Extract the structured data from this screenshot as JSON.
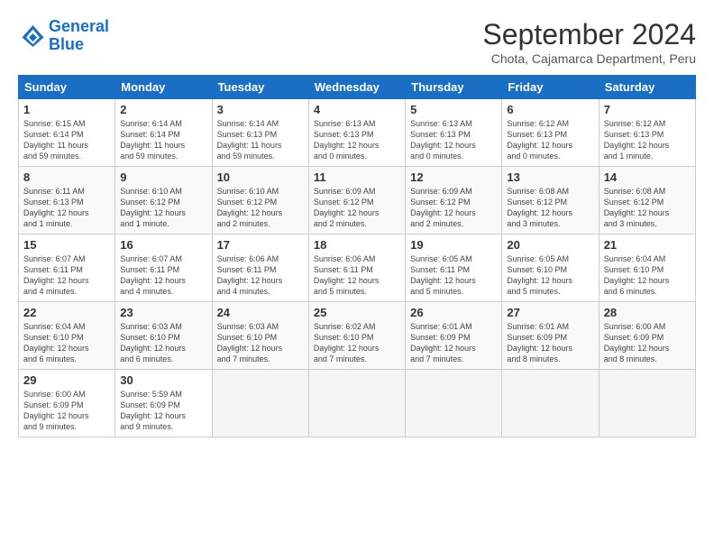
{
  "logo": {
    "line1": "General",
    "line2": "Blue"
  },
  "title": "September 2024",
  "subtitle": "Chota, Cajamarca Department, Peru",
  "headers": [
    "Sunday",
    "Monday",
    "Tuesday",
    "Wednesday",
    "Thursday",
    "Friday",
    "Saturday"
  ],
  "weeks": [
    [
      {
        "day": "1",
        "info": "Sunrise: 6:15 AM\nSunset: 6:14 PM\nDaylight: 11 hours\nand 59 minutes."
      },
      {
        "day": "2",
        "info": "Sunrise: 6:14 AM\nSunset: 6:14 PM\nDaylight: 11 hours\nand 59 minutes."
      },
      {
        "day": "3",
        "info": "Sunrise: 6:14 AM\nSunset: 6:13 PM\nDaylight: 11 hours\nand 59 minutes."
      },
      {
        "day": "4",
        "info": "Sunrise: 6:13 AM\nSunset: 6:13 PM\nDaylight: 12 hours\nand 0 minutes."
      },
      {
        "day": "5",
        "info": "Sunrise: 6:13 AM\nSunset: 6:13 PM\nDaylight: 12 hours\nand 0 minutes."
      },
      {
        "day": "6",
        "info": "Sunrise: 6:12 AM\nSunset: 6:13 PM\nDaylight: 12 hours\nand 0 minutes."
      },
      {
        "day": "7",
        "info": "Sunrise: 6:12 AM\nSunset: 6:13 PM\nDaylight: 12 hours\nand 1 minute."
      }
    ],
    [
      {
        "day": "8",
        "info": "Sunrise: 6:11 AM\nSunset: 6:13 PM\nDaylight: 12 hours\nand 1 minute."
      },
      {
        "day": "9",
        "info": "Sunrise: 6:10 AM\nSunset: 6:12 PM\nDaylight: 12 hours\nand 1 minute."
      },
      {
        "day": "10",
        "info": "Sunrise: 6:10 AM\nSunset: 6:12 PM\nDaylight: 12 hours\nand 2 minutes."
      },
      {
        "day": "11",
        "info": "Sunrise: 6:09 AM\nSunset: 6:12 PM\nDaylight: 12 hours\nand 2 minutes."
      },
      {
        "day": "12",
        "info": "Sunrise: 6:09 AM\nSunset: 6:12 PM\nDaylight: 12 hours\nand 2 minutes."
      },
      {
        "day": "13",
        "info": "Sunrise: 6:08 AM\nSunset: 6:12 PM\nDaylight: 12 hours\nand 3 minutes."
      },
      {
        "day": "14",
        "info": "Sunrise: 6:08 AM\nSunset: 6:12 PM\nDaylight: 12 hours\nand 3 minutes."
      }
    ],
    [
      {
        "day": "15",
        "info": "Sunrise: 6:07 AM\nSunset: 6:11 PM\nDaylight: 12 hours\nand 4 minutes."
      },
      {
        "day": "16",
        "info": "Sunrise: 6:07 AM\nSunset: 6:11 PM\nDaylight: 12 hours\nand 4 minutes."
      },
      {
        "day": "17",
        "info": "Sunrise: 6:06 AM\nSunset: 6:11 PM\nDaylight: 12 hours\nand 4 minutes."
      },
      {
        "day": "18",
        "info": "Sunrise: 6:06 AM\nSunset: 6:11 PM\nDaylight: 12 hours\nand 5 minutes."
      },
      {
        "day": "19",
        "info": "Sunrise: 6:05 AM\nSunset: 6:11 PM\nDaylight: 12 hours\nand 5 minutes."
      },
      {
        "day": "20",
        "info": "Sunrise: 6:05 AM\nSunset: 6:10 PM\nDaylight: 12 hours\nand 5 minutes."
      },
      {
        "day": "21",
        "info": "Sunrise: 6:04 AM\nSunset: 6:10 PM\nDaylight: 12 hours\nand 6 minutes."
      }
    ],
    [
      {
        "day": "22",
        "info": "Sunrise: 6:04 AM\nSunset: 6:10 PM\nDaylight: 12 hours\nand 6 minutes."
      },
      {
        "day": "23",
        "info": "Sunrise: 6:03 AM\nSunset: 6:10 PM\nDaylight: 12 hours\nand 6 minutes."
      },
      {
        "day": "24",
        "info": "Sunrise: 6:03 AM\nSunset: 6:10 PM\nDaylight: 12 hours\nand 7 minutes."
      },
      {
        "day": "25",
        "info": "Sunrise: 6:02 AM\nSunset: 6:10 PM\nDaylight: 12 hours\nand 7 minutes."
      },
      {
        "day": "26",
        "info": "Sunrise: 6:01 AM\nSunset: 6:09 PM\nDaylight: 12 hours\nand 7 minutes."
      },
      {
        "day": "27",
        "info": "Sunrise: 6:01 AM\nSunset: 6:09 PM\nDaylight: 12 hours\nand 8 minutes."
      },
      {
        "day": "28",
        "info": "Sunrise: 6:00 AM\nSunset: 6:09 PM\nDaylight: 12 hours\nand 8 minutes."
      }
    ],
    [
      {
        "day": "29",
        "info": "Sunrise: 6:00 AM\nSunset: 6:09 PM\nDaylight: 12 hours\nand 9 minutes."
      },
      {
        "day": "30",
        "info": "Sunrise: 5:59 AM\nSunset: 6:09 PM\nDaylight: 12 hours\nand 9 minutes."
      },
      {
        "day": "",
        "info": ""
      },
      {
        "day": "",
        "info": ""
      },
      {
        "day": "",
        "info": ""
      },
      {
        "day": "",
        "info": ""
      },
      {
        "day": "",
        "info": ""
      }
    ]
  ]
}
